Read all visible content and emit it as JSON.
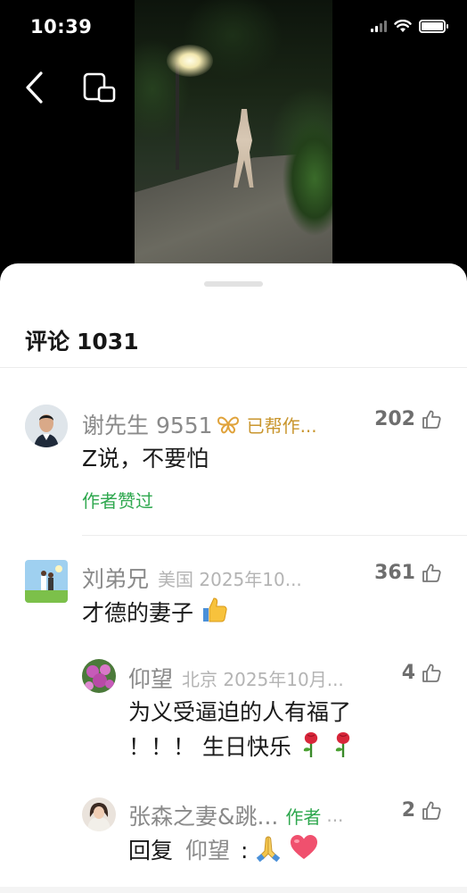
{
  "status_bar": {
    "time": "10:39"
  },
  "nav": {
    "back_icon": "chevron-left-icon",
    "pip_icon": "picture-in-picture-icon"
  },
  "sheet": {
    "title": "评论",
    "count": "1031"
  },
  "comments": [
    {
      "name": "谢先生 9551",
      "badge_icon": "butterfly-badge-icon",
      "tag": "已帮作...",
      "likes": "202",
      "text": "Z说，不要怕",
      "sub": "作者赞过"
    },
    {
      "name": "刘弟兄",
      "meta": "美国 2025年10...",
      "likes": "361",
      "text": "才德的妻子",
      "emoji_icon": "thumbs-up-emoji-icon"
    }
  ],
  "replies": [
    {
      "name": "仰望",
      "meta": "北京 2025年10月...",
      "likes": "4",
      "text_line1": "为义受逼迫的人有福了",
      "text_line2": "！！！ 生日快乐",
      "emoji_icon": "rose-emoji-icon"
    },
    {
      "name": "张森之妻&跳...",
      "author_tag": "作者",
      "meta": "...",
      "likes": "2",
      "reply_prefix": "回复",
      "reply_to": "仰望",
      "reply_sep": ":",
      "emoji_icons": [
        "praying-hands-emoji-icon",
        "heart-emoji-icon"
      ]
    }
  ],
  "colors": {
    "accent_green": "#2fa84f",
    "badge_gold": "#c9962e"
  }
}
